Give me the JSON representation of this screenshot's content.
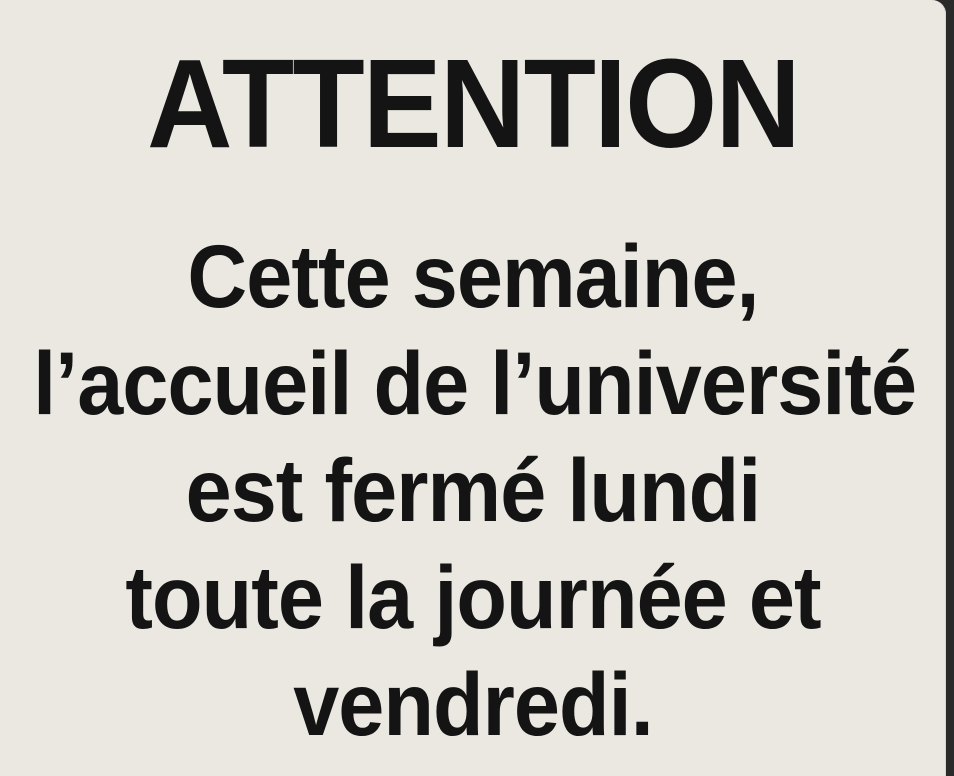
{
  "notice": {
    "title": "ATTENTION",
    "lines": [
      "Cette semaine,",
      "l’accueil de l’université",
      "est fermé lundi",
      "toute la journée et",
      "vendredi."
    ]
  }
}
